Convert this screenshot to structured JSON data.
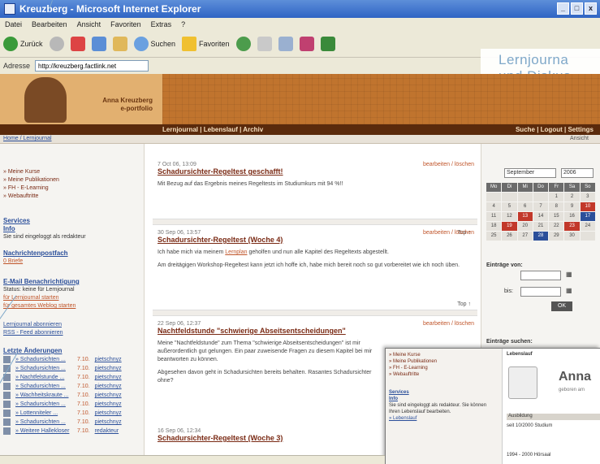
{
  "window": {
    "title": "Kreuzberg - Microsoft Internet Explorer",
    "buttons": [
      "_",
      "□",
      "x"
    ]
  },
  "menubar": {
    "items": [
      "Datei",
      "Bearbeiten",
      "Ansicht",
      "Favoriten",
      "Extras",
      "?"
    ]
  },
  "toolbar": {
    "back": "Zurück",
    "search": "Suchen",
    "favorites": "Favoriten"
  },
  "address": {
    "label": "Adresse",
    "url": "http://kreuzberg.factlink.net"
  },
  "overlay": {
    "line1": "Lernjourna",
    "line2": "und Diskus"
  },
  "banner": {
    "name_line1": "Anna Kreuzberg",
    "name_line2": "e-portfolio"
  },
  "nav": {
    "left": "Lernjournal  |  Lebenslauf  |  Archiv",
    "right": "Suche | Logout | Settings"
  },
  "breadcrumb": {
    "left": "Home / Lernjournal",
    "right": "Ansicht"
  },
  "left": {
    "nav_items": [
      "» Meine Kurse",
      "» Meine Publikationen",
      "» FH - E-Learning",
      "» Webauftritte"
    ],
    "sections": {
      "services": "Services",
      "info": "Info",
      "info_text": "Sie sind eingeloggt als redakteur",
      "notify_title": "Nachrichtenpostfach",
      "notify_link": "0 Briefe",
      "mail_title": "E-Mail Benachrichtigung",
      "mail_text": "Status: keine für Lernjournal",
      "mail_link1": "für Lernjournal starten",
      "mail_link2": "für gesamtes Weblog starten",
      "links1": "Lernjournal abonnieren",
      "links2": "RSS - Feed abonnieren",
      "recent_title": "Letzte Änderungen"
    },
    "recent": [
      {
        "title": "» Schadursichten ...",
        "date": "7.10.",
        "user": "pietschnyz"
      },
      {
        "title": "» Schadursichten ...",
        "date": "7.10.",
        "user": "pietschnyz"
      },
      {
        "title": "» Nachtfelstunde ...",
        "date": "7.10.",
        "user": "pietschnyz"
      },
      {
        "title": "» Schadursichten ...",
        "date": "7.10.",
        "user": "pietschnyz"
      },
      {
        "title": "» Wachheitskraute ...",
        "date": "7.10.",
        "user": "pietschnyz"
      },
      {
        "title": "» Schadursichten ...",
        "date": "7.10.",
        "user": "pietschnyz"
      },
      {
        "title": "» Lottenniteler ...",
        "date": "7.10.",
        "user": "pietschnyz"
      },
      {
        "title": "» Schadursichten ...",
        "date": "7.10.",
        "user": "pietschnyz"
      },
      {
        "title": "» Weitere Hallekloser",
        "date": "7.10.",
        "user": "redakteur"
      }
    ]
  },
  "entries": [
    {
      "date": "7 Oct 06, 13:09",
      "title": "Schadursichter-Regeltest geschafft!",
      "actions": "bearbeiten / löschen",
      "text": "Mit Bezug auf das Ergebnis meines Regeltests im Studiumkurs mit 94 %!!",
      "top": "Top ↑"
    },
    {
      "date": "30 Sep 06, 13:57",
      "title": "Schadursichter-Regeltest (Woche 4)",
      "actions": "bearbeiten / löschen",
      "link": "Lernplan",
      "text_before": "Ich habe mich via meinem",
      "text_after": "geholfen und nun alle Kapitel des Regeltexts abgestellt.",
      "text2": "Am dreitägigen Workshop-Regeltest kann jetzt ich hoffe ich, habe mich bereit noch so gut vorbereitet wie ich noch üben.",
      "top": "Top ↑"
    },
    {
      "date": "22 Sep 06, 12:37",
      "title": "Nachtfeldstunde \"schwierige Abseitsentscheidungen\"",
      "actions": "bearbeiten / löschen",
      "text": "Meine \"Nachtfeldstunde\" zum Thema \"schwierige Abseitsentscheidungen\" ist mir außerordentlich gut gelungen. Ein paar zuweisende Fragen zu diesem Kapitel bei mir beantworten zu können.",
      "text2": "Abgesehen davon geht in Schadursichten bereits behalten. Rasantes Schadursichter ohne?",
      "top": "Top ↑"
    },
    {
      "date": "16 Sep 06, 12:34",
      "title": "Schadursichter-Regeltest (Woche 3)",
      "actions": "",
      "text": "",
      "top": ""
    }
  ],
  "right": {
    "month": "September",
    "year": "2006",
    "weekdays": [
      "Mo",
      "Di",
      "Mi",
      "Do",
      "Fr",
      "Sa",
      "So"
    ],
    "days": [
      "",
      "",
      "",
      "",
      "1",
      "2",
      "3",
      "4",
      "5",
      "6",
      "7",
      "8",
      "9",
      "10",
      "11",
      "12",
      "13",
      "14",
      "15",
      "16",
      "17",
      "18",
      "19",
      "20",
      "21",
      "22",
      "23",
      "24",
      "25",
      "26",
      "27",
      "28",
      "29",
      "30",
      ""
    ],
    "entries_from": "Einträge von:",
    "to": "bis:",
    "ok": "OK",
    "search_title": "Einträge suchen:"
  },
  "inset": {
    "nav_items": [
      "» Meine Kurse",
      "» Meine Publikationen",
      "» FH - E-Learning",
      "» Webauftritte"
    ],
    "services": "Services",
    "info": "Info",
    "info_text": "Sie sind eingeloggt als redakteur. Sie können Ihren Lebenslauf bearbeiten.",
    "link": "» Lebenslauf",
    "heading": "Lebenslauf",
    "name": "Anna",
    "born": "geboren am",
    "section": "Ausbildung",
    "edu1": "seit 10/2000 Studium",
    "edu2": "1994 - 2000 Hörsaal"
  }
}
